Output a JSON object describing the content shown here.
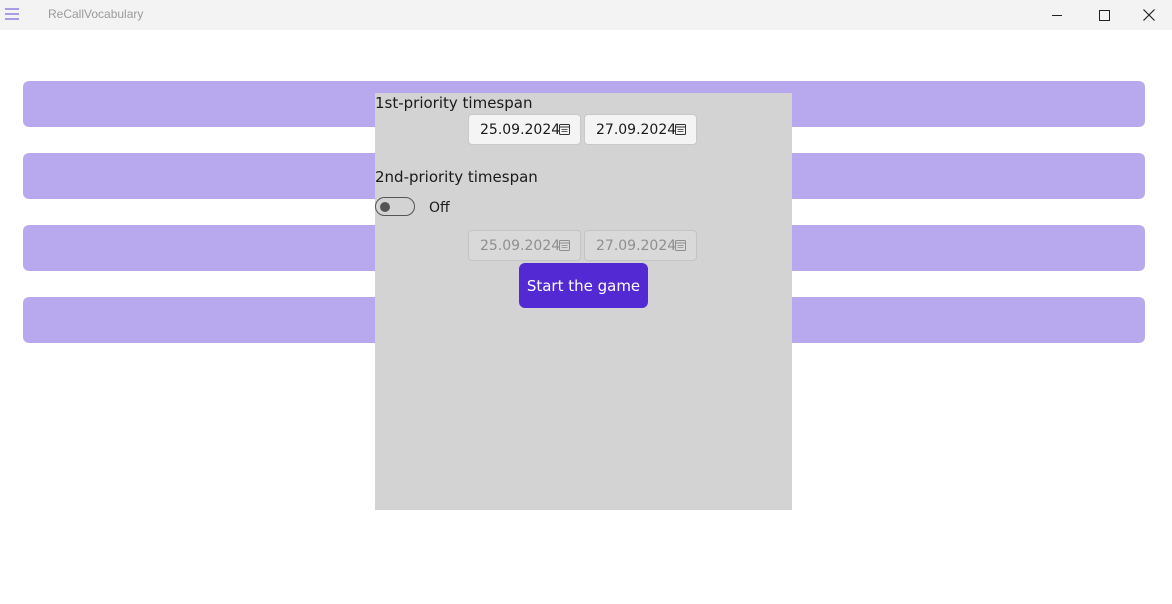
{
  "window": {
    "title": "ReCallVocabulary",
    "controls": {
      "minimize": "minimize-icon",
      "maximize": "maximize-icon",
      "close": "close-icon"
    }
  },
  "colors": {
    "accent": "#5229d3",
    "menu_bar": "#b8a9ee",
    "panel": "#d3d3d3"
  },
  "menu_bars": [
    "",
    "",
    "",
    ""
  ],
  "dialog": {
    "first_priority": {
      "label": "1st-priority timespan",
      "start_date": "25.09.2024",
      "end_date": "27.09.2024"
    },
    "second_priority": {
      "label": "2nd-priority timespan",
      "toggle_state": "Off",
      "start_date": "25.09.2024",
      "end_date": "27.09.2024",
      "enabled": false
    },
    "start_button": "Start the game"
  }
}
